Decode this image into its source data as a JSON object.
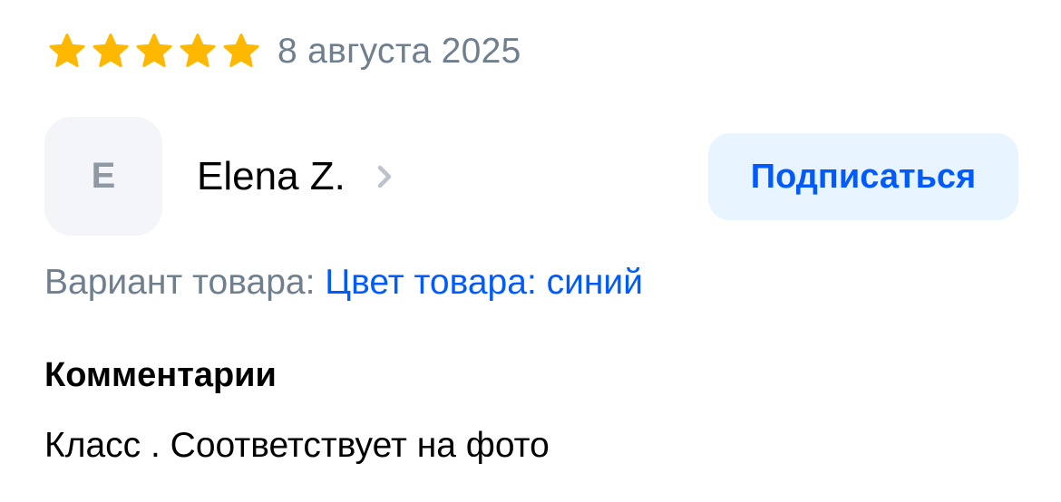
{
  "rating": {
    "stars_filled": 5,
    "stars_total": 5,
    "star_color": "#ffb800",
    "date": "8 августа 2025"
  },
  "author": {
    "avatar_letter": "E",
    "name": "Elena Z.",
    "chevron_icon": "chevron-right-icon"
  },
  "subscribe": {
    "label": "Подписаться",
    "bg_color": "#e8f4ff",
    "text_color": "#005bff"
  },
  "variant": {
    "label": "Вариант товара:",
    "value": "Цвет товара: синий"
  },
  "comments": {
    "title": "Комментарии",
    "text": "Класс . Соответствует на фото"
  },
  "colors": {
    "muted_text": "#707f8d",
    "link_blue": "#005bff",
    "avatar_bg": "#f3f5f8"
  }
}
